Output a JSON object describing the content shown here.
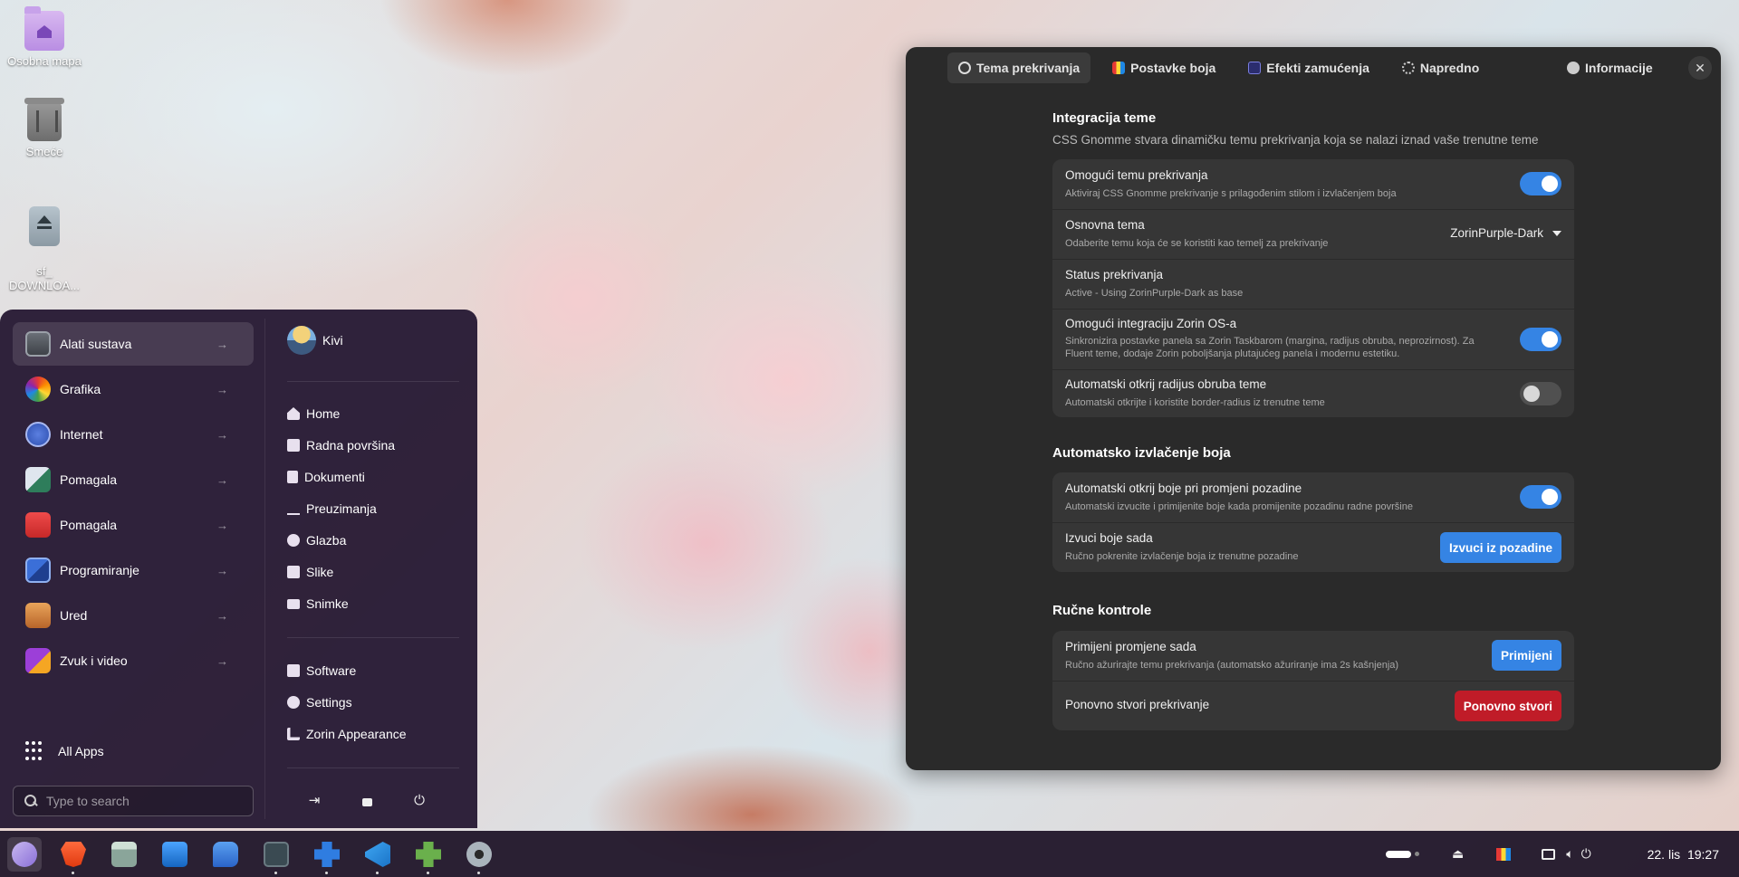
{
  "desktop": {
    "icons": [
      {
        "label": "Osobna mapa",
        "icon": "home-folder-icon"
      },
      {
        "label": "Smeće",
        "icon": "trash-icon"
      },
      {
        "label": "sf_\nDOWNLOA...",
        "icon": "drive-icon"
      }
    ]
  },
  "start_menu": {
    "categories": [
      {
        "label": "Alati sustava",
        "icon": "system-tools-icon",
        "active": true
      },
      {
        "label": "Grafika",
        "icon": "graphics-icon"
      },
      {
        "label": "Internet",
        "icon": "internet-icon"
      },
      {
        "label": "Pomagala",
        "icon": "accessories-icon"
      },
      {
        "label": "Pomagala",
        "icon": "utilities-icon"
      },
      {
        "label": "Programiranje",
        "icon": "programming-icon"
      },
      {
        "label": "Ured",
        "icon": "office-icon"
      },
      {
        "label": "Zvuk i video",
        "icon": "sound-video-icon"
      }
    ],
    "arrow": "→",
    "all_apps": "All Apps",
    "search_placeholder": "Type to search",
    "user": "Kivi",
    "places": [
      {
        "label": "Home",
        "icon": "home-icon"
      },
      {
        "label": "Radna površina",
        "icon": "desktop-icon"
      },
      {
        "label": "Dokumenti",
        "icon": "document-icon"
      },
      {
        "label": "Preuzimanja",
        "icon": "download-icon"
      },
      {
        "label": "Glazba",
        "icon": "music-icon"
      },
      {
        "label": "Slike",
        "icon": "image-icon"
      },
      {
        "label": "Snimke",
        "icon": "video-icon"
      }
    ],
    "apps": [
      {
        "label": "Software",
        "icon": "software-icon"
      },
      {
        "label": "Settings",
        "icon": "settings-icon"
      },
      {
        "label": "Zorin Appearance",
        "icon": "appearance-icon"
      }
    ],
    "power_buttons": [
      "logout-icon",
      "lock-icon",
      "power-icon"
    ]
  },
  "window": {
    "tabs": [
      {
        "label": "Tema prekrivanja",
        "active": true
      },
      {
        "label": "Postavke boja"
      },
      {
        "label": "Efekti zamućenja"
      },
      {
        "label": "Napredno"
      },
      {
        "label": "Informacije"
      }
    ],
    "close": "✕",
    "section1": {
      "title": "Integracija teme",
      "desc": "CSS Gnomme stvara dinamičku temu prekrivanja koja se nalazi iznad vaše trenutne teme",
      "rows": [
        {
          "title": "Omogući temu prekrivanja",
          "sub": "Aktiviraj CSS Gnomme prekrivanje s prilagođenim stilom i izvlačenjem boja",
          "toggle": true
        },
        {
          "title": "Osnovna tema",
          "sub": "Odaberite temu koja će se koristiti kao temelj za prekrivanje",
          "value": "ZorinPurple-Dark"
        },
        {
          "title": "Status prekrivanja",
          "sub": "Active - Using ZorinPurple-Dark as base"
        },
        {
          "title": "Omogući integraciju Zorin OS-a",
          "sub1": "Sinkronizira postavke panela sa Zorin Taskbarom (margina, radijus obruba, neprozirnost). Za",
          "sub2": "Fluent teme, dodaje Zorin poboljšanja plutajućeg panela i modernu estetiku.",
          "toggle": true
        },
        {
          "title": "Automatski otkrij radijus obruba teme",
          "sub": "Automatski otkrijte i koristite border-radius iz trenutne teme",
          "toggle": false
        }
      ]
    },
    "section2": {
      "title": "Automatsko izvlačenje boja",
      "rows": [
        {
          "title": "Automatski otkrij boje pri promjeni pozadine",
          "sub": "Automatski izvucite i primijenite boje kada promijenite pozadinu radne površine",
          "toggle": true
        },
        {
          "title": "Izvuci boje sada",
          "sub": "Ručno pokrenite izvlačenje boja iz trenutne pozadine",
          "button": "Izvuci iz pozadine"
        }
      ]
    },
    "section3": {
      "title": "Ručne kontrole",
      "rows": [
        {
          "title": "Primijeni promjene sada",
          "sub": "Ručno ažurirajte temu prekrivanja (automatsko ažuriranje ima 2s kašnjenja)",
          "button": "Primijeni"
        },
        {
          "title": "Ponovno stvori prekrivanje",
          "button": "Ponovno stvori"
        }
      ]
    }
  },
  "taskbar": {
    "apps": [
      "zorin-menu-icon",
      "brave-browser-icon",
      "files-icon",
      "software-store-icon",
      "chat-icon",
      "terminal-icon",
      "extensions-icon",
      "vscode-icon",
      "puzzle-icon",
      "settings-gear-icon"
    ],
    "clock": "22. lis  19:27"
  },
  "colors": {
    "accent": "#3584e4",
    "danger": "#c01c28",
    "window_bg": "#2a2a2a",
    "row_bg": "#363636",
    "menu_bg": "#281a34"
  }
}
